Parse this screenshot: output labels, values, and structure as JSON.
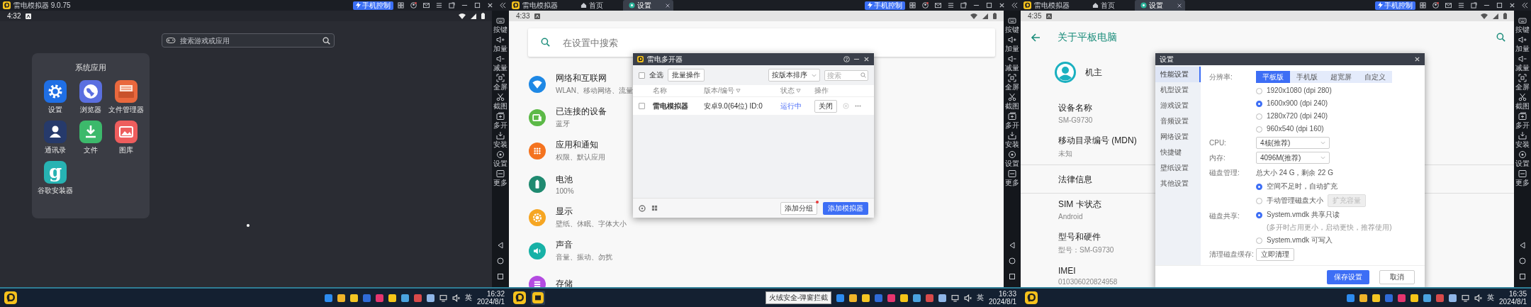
{
  "left_window": {
    "title": "雷电模拟器 9.0.75",
    "phone_control": "手机控制",
    "status_time": "4:32",
    "search": {
      "placeholder": "搜索游戏或应用"
    },
    "folder": {
      "title": "系统应用",
      "apps": [
        {
          "label": "设置",
          "kind": "settings"
        },
        {
          "label": "浏览器",
          "kind": "browser"
        },
        {
          "label": "文件管理器",
          "kind": "files"
        },
        {
          "label": "通讯录",
          "kind": "contacts"
        },
        {
          "label": "文件",
          "kind": "download"
        },
        {
          "label": "图库",
          "kind": "gallery"
        },
        {
          "label": "谷歌安装器",
          "kind": "google",
          "glyph": "g"
        }
      ]
    },
    "toolbar": [
      {
        "label": "按键",
        "kind": "keys"
      },
      {
        "label": "加量",
        "kind": "volup"
      },
      {
        "label": "减量",
        "kind": "voldown"
      },
      {
        "label": "全屏",
        "kind": "fullscreen"
      },
      {
        "label": "截图",
        "kind": "screenshot"
      },
      {
        "label": "多开",
        "kind": "multi"
      },
      {
        "label": "安装",
        "kind": "install"
      },
      {
        "label": "设置",
        "kind": "settings"
      },
      {
        "label": "更多",
        "kind": "more"
      }
    ],
    "taskbar": {
      "language": "英",
      "time": "16:32",
      "date": "2024/8/1"
    }
  },
  "middle_window": {
    "brand": "雷电模拟器",
    "tabs": [
      {
        "label": "首页",
        "kind": "home",
        "selected": false
      },
      {
        "label": "设置",
        "kind": "settings",
        "selected": true
      }
    ],
    "phone_control": "手机控制",
    "status_time": "4:33",
    "search": {
      "placeholder": "在设置中搜索"
    },
    "settings_list": [
      {
        "title": "网络和互联网",
        "subtitle": "WLAN、移动网络、流量",
        "kind": "wifi",
        "color": "#1e88e5"
      },
      {
        "title": "已连接的设备",
        "subtitle": "蓝牙",
        "kind": "devices",
        "color": "#5cb947"
      },
      {
        "title": "应用和通知",
        "subtitle": "权限、默认应用",
        "kind": "apps",
        "color": "#f4731f"
      },
      {
        "title": "电池",
        "subtitle": "100%",
        "kind": "battery",
        "color": "#1f8a70"
      },
      {
        "title": "显示",
        "subtitle": "壁纸、休眠、字体大小",
        "kind": "display",
        "color": "#f6a623"
      },
      {
        "title": "声音",
        "subtitle": "音量、振动、勿扰",
        "kind": "sound",
        "color": "#17b1a6"
      },
      {
        "title": "存储",
        "kind": "storage",
        "color": "#b44be1"
      }
    ],
    "multi_instance_dialog": {
      "title": "雷电多开器",
      "select_all": {
        "label": "全选",
        "checked": false
      },
      "batch": "批量操作",
      "sort": "按版本排序",
      "search_placeholder": "搜索",
      "columns": [
        {
          "label": "名称",
          "filter": false
        },
        {
          "label": "版本/编号",
          "filter": true
        },
        {
          "label": "状态",
          "filter": true
        },
        {
          "label": "操作",
          "filter": false
        }
      ],
      "rows": [
        {
          "checked": false,
          "name": "雷电模拟器",
          "version": "安卓9.0(64位) ID:0",
          "status": "运行中",
          "action": "关闭"
        }
      ],
      "add_group": {
        "label": "添加分组",
        "new": true
      },
      "add_emulator": "添加模拟器"
    },
    "toolbar": [
      {
        "label": "按键",
        "kind": "keys"
      },
      {
        "label": "加量",
        "kind": "volup"
      },
      {
        "label": "减量",
        "kind": "voldown"
      },
      {
        "label": "全屏",
        "kind": "fullscreen"
      },
      {
        "label": "截图",
        "kind": "screenshot"
      },
      {
        "label": "多开",
        "kind": "multi"
      },
      {
        "label": "安装",
        "kind": "install"
      },
      {
        "label": "设置",
        "kind": "settings"
      },
      {
        "label": "更多",
        "kind": "more"
      }
    ],
    "taskbar": {
      "tooltip": "火绒安全-弹窗拦截",
      "language": "英",
      "time": "16:33",
      "date": "2024/8/1"
    }
  },
  "right_window": {
    "brand": "雷电模拟器",
    "tabs": [
      {
        "label": "首页",
        "kind": "home",
        "selected": false
      },
      {
        "label": "设置",
        "kind": "settings",
        "selected": true
      }
    ],
    "phone_control": "手机控制",
    "status_time": "4:35",
    "page_title": "关于平板电脑",
    "owner": "机主",
    "info_list": [
      {
        "title": "设备名称",
        "value": "SM-G9730",
        "kind": "detail"
      },
      {
        "title": "移动目录编号 (MDN)",
        "value": "未知",
        "kind": "detail"
      },
      {
        "title": "法律信息",
        "kind": "section"
      },
      {
        "title": "SIM 卡状态",
        "value": "Android",
        "kind": "detail"
      },
      {
        "title": "型号和硬件",
        "value": "型号：SM-G9730",
        "kind": "detail"
      },
      {
        "title": "IMEI",
        "value": "010306020824958",
        "kind": "detail"
      }
    ],
    "settings_dialog": {
      "title": "设置",
      "nav": [
        {
          "label": "性能设置",
          "selected": true
        },
        {
          "label": "机型设置",
          "selected": false
        },
        {
          "label": "游戏设置",
          "selected": false
        },
        {
          "label": "音频设置",
          "selected": false
        },
        {
          "label": "网络设置",
          "selected": false
        },
        {
          "label": "快捷键",
          "selected": false
        },
        {
          "label": "壁纸设置",
          "selected": false
        },
        {
          "label": "其他设置",
          "selected": false
        }
      ],
      "resolution": {
        "label": "分辨率:",
        "modes": [
          {
            "label": "平板版",
            "selected": true
          },
          {
            "label": "手机版",
            "selected": false
          },
          {
            "label": "超宽屏",
            "selected": false
          },
          {
            "label": "自定义",
            "selected": false
          }
        ],
        "options": [
          {
            "label": "1920x1080 (dpi 280)",
            "selected": false
          },
          {
            "label": "1600x900 (dpi 240)",
            "selected": true
          },
          {
            "label": "1280x720 (dpi 240)",
            "selected": false
          },
          {
            "label": "960x540 (dpi 160)",
            "selected": false
          }
        ]
      },
      "cpu": {
        "label": "CPU:",
        "value": "4核(推荐)"
      },
      "memory": {
        "label": "内存:",
        "value": "4096M(推荐)"
      },
      "disk": {
        "label": "磁盘管理:",
        "summary": "总大小 24 G，剩余 22 G",
        "options": [
          {
            "label": "空间不足时，自动扩充",
            "selected": true
          },
          {
            "label": "手动管理磁盘大小",
            "selected": false
          }
        ],
        "expand_button": {
          "label": "扩充容量",
          "disabled": true
        }
      },
      "sharing": {
        "label": "磁盘共享:",
        "options": [
          {
            "label": "System.vmdk 共享只读",
            "hint": "(多开时占用更小，启动更快，推荐使用)",
            "selected": true
          },
          {
            "label": "System.vmdk 可写入",
            "selected": false
          }
        ]
      },
      "cache": {
        "label": "清理磁盘缓存:",
        "button": "立即清理"
      },
      "save": "保存设置",
      "cancel": "取消"
    },
    "toolbar": [
      {
        "label": "按键",
        "kind": "keys"
      },
      {
        "label": "加量",
        "kind": "volup"
      },
      {
        "label": "减量",
        "kind": "voldown"
      },
      {
        "label": "全屏",
        "kind": "fullscreen"
      },
      {
        "label": "截图",
        "kind": "screenshot"
      },
      {
        "label": "多开",
        "kind": "multi"
      },
      {
        "label": "安装",
        "kind": "install"
      },
      {
        "label": "设置",
        "kind": "settings"
      },
      {
        "label": "更多",
        "kind": "more"
      }
    ],
    "taskbar": {
      "language": "英",
      "time": "16:35",
      "date": "2024/8/1"
    }
  }
}
